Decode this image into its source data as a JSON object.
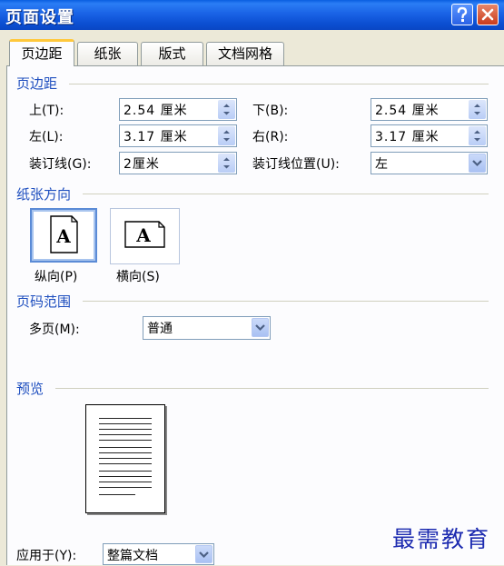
{
  "window": {
    "title": "页面设置"
  },
  "tabs": [
    {
      "label": "页边距",
      "active": true
    },
    {
      "label": "纸张",
      "active": false
    },
    {
      "label": "版式",
      "active": false
    },
    {
      "label": "文档网格",
      "active": false
    }
  ],
  "margins": {
    "section_title": "页边距",
    "top_label": "上(T):",
    "top_value": "2.54 厘米",
    "bottom_label": "下(B):",
    "bottom_value": "2.54 厘米",
    "left_label": "左(L):",
    "left_value": "3.17 厘米",
    "right_label": "右(R):",
    "right_value": "3.17 厘米",
    "gutter_label": "装订线(G):",
    "gutter_value": "2厘米",
    "gutter_position_label": "装订线位置(U):",
    "gutter_position_value": "左"
  },
  "orientation": {
    "section_title": "纸张方向",
    "portrait_label": "纵向(P)",
    "landscape_label": "横向(S)",
    "icon_letter": "A",
    "selected": "portrait"
  },
  "pages": {
    "section_title": "页码范围",
    "multiple_label": "多页(M):",
    "multiple_value": "普通"
  },
  "preview": {
    "section_title": "预览",
    "apply_label": "应用于(Y):",
    "apply_value": "整篇文档"
  },
  "watermark": {
    "text": "最需教育"
  },
  "colors": {
    "titlebar": "#0b4ed1",
    "section_title": "#1f4fbf",
    "active_tab_accent": "#ffc83c",
    "close_button": "#c93b1c",
    "watermark": "#1d2bb0"
  },
  "icons": [
    "help-icon",
    "close-icon",
    "spin-up-icon",
    "spin-down-icon",
    "dropdown-arrow-icon",
    "portrait-page-icon",
    "landscape-page-icon"
  ]
}
